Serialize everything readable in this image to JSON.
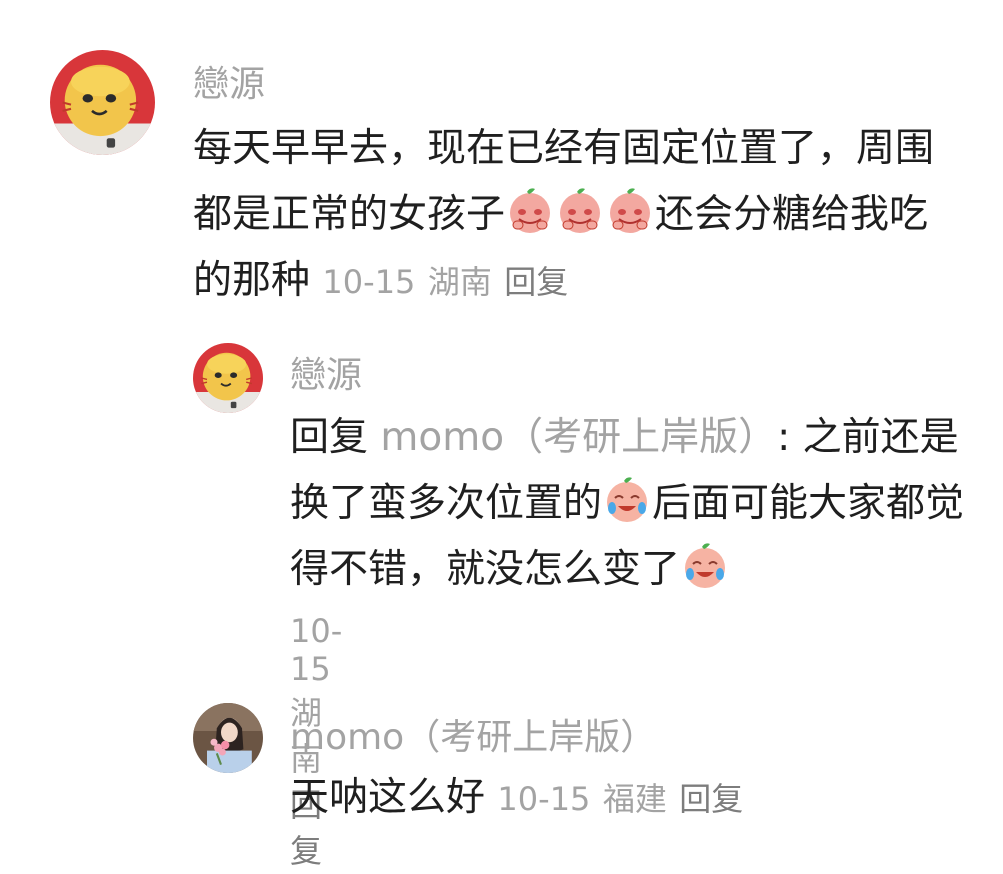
{
  "comments": [
    {
      "author": "戀源",
      "avatar_icon": "lion-avatar-icon",
      "text_part1": "每天早早去，现在已经有固定位置了，周围都是正常的女孩子",
      "emojis": [
        "shy-peach-emoji",
        "shy-peach-emoji",
        "shy-peach-emoji"
      ],
      "text_part2": "还会分糖给我吃的那种",
      "date": "10-15",
      "location": "湖南",
      "reply_label": "回复"
    },
    {
      "author": "戀源",
      "avatar_icon": "lion-avatar-icon",
      "reply_prefix": "回复",
      "reply_target": "momo（考研上岸版）",
      "text_part1": ": 之前还是换了蛮多次位置的",
      "emoji1": "crying-laugh-peach-emoji",
      "text_part2": "后面可能大家都觉得不错，就没怎么变了",
      "emoji2": "crying-laugh-peach-emoji",
      "date": "10-15",
      "location": "湖南",
      "reply_label": "回复"
    },
    {
      "author": "momo（考研上岸版）",
      "avatar_icon": "girl-with-flowers-avatar-icon",
      "text": "天呐这么好",
      "date": "10-15",
      "location": "福建",
      "reply_label": "回复"
    }
  ]
}
